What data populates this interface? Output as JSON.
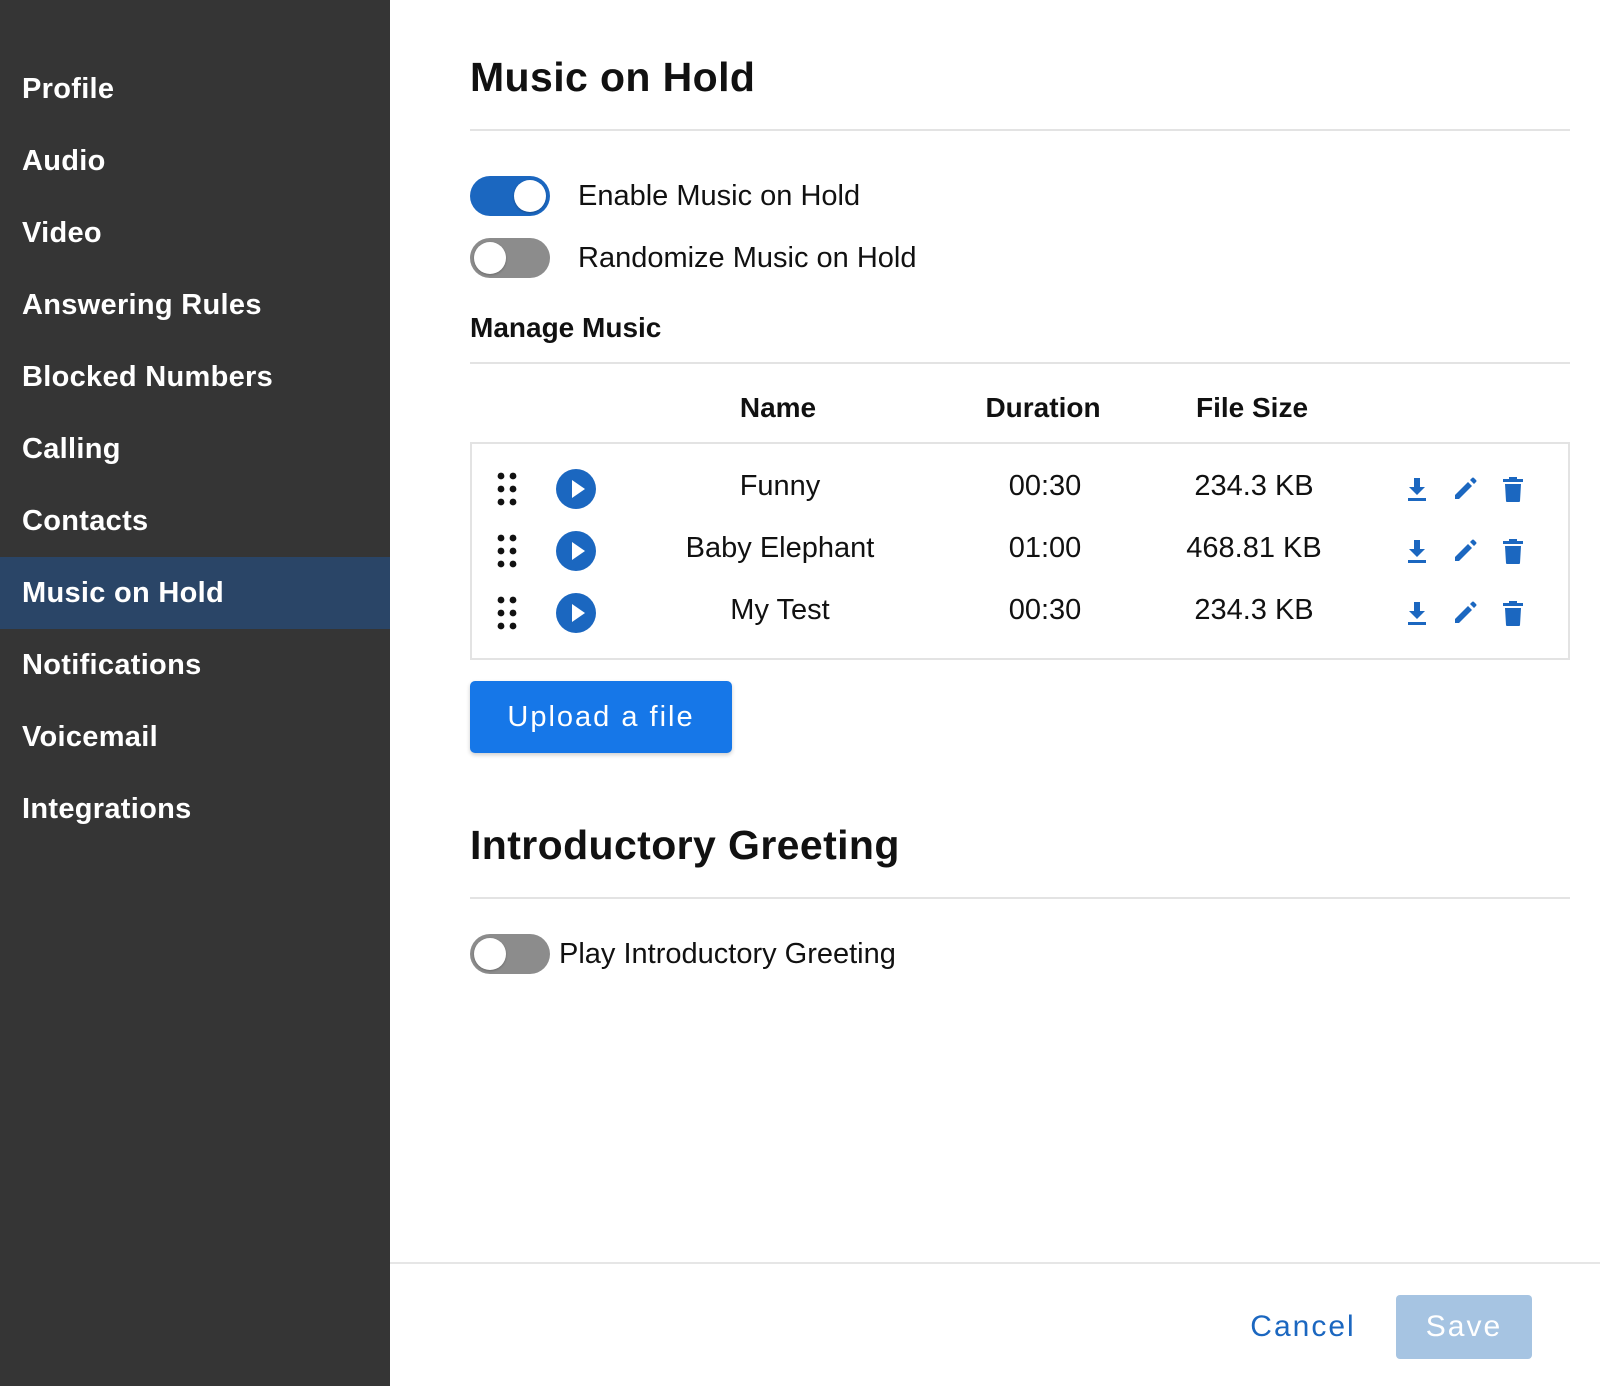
{
  "sidebar": {
    "items": [
      {
        "label": "Profile"
      },
      {
        "label": "Audio"
      },
      {
        "label": "Video"
      },
      {
        "label": "Answering Rules"
      },
      {
        "label": "Blocked Numbers"
      },
      {
        "label": "Calling"
      },
      {
        "label": "Contacts"
      },
      {
        "label": "Music on Hold",
        "active": true
      },
      {
        "label": "Notifications"
      },
      {
        "label": "Voicemail"
      },
      {
        "label": "Integrations"
      }
    ]
  },
  "music_on_hold": {
    "title": "Music on Hold",
    "enable_toggle": {
      "label": "Enable Music on Hold",
      "on": true
    },
    "randomize_toggle": {
      "label": "Randomize Music on Hold",
      "on": false
    },
    "manage_title": "Manage Music",
    "table": {
      "columns": [
        "Name",
        "Duration",
        "File Size"
      ],
      "rows": [
        {
          "name": "Funny",
          "duration": "00:30",
          "size": "234.3 KB"
        },
        {
          "name": "Baby Elephant",
          "duration": "01:00",
          "size": "468.81 KB"
        },
        {
          "name": "My Test",
          "duration": "00:30",
          "size": "234.3 KB"
        }
      ],
      "row_icons": [
        "drag-handle-icon",
        "play-icon",
        "download-icon",
        "edit-icon",
        "delete-icon"
      ]
    },
    "upload_label": "Upload a file"
  },
  "intro_greeting": {
    "title": "Introductory Greeting",
    "toggle": {
      "label": "Play Introductory Greeting",
      "on": false
    }
  },
  "footer": {
    "cancel_label": "Cancel",
    "save_label": "Save"
  },
  "colors": {
    "sidebar_bg": "#353535",
    "sidebar_active": "#2a4567",
    "accent": "#1b67c0",
    "upload_button": "#1677e8",
    "save_disabled": "#a6c4e2"
  }
}
